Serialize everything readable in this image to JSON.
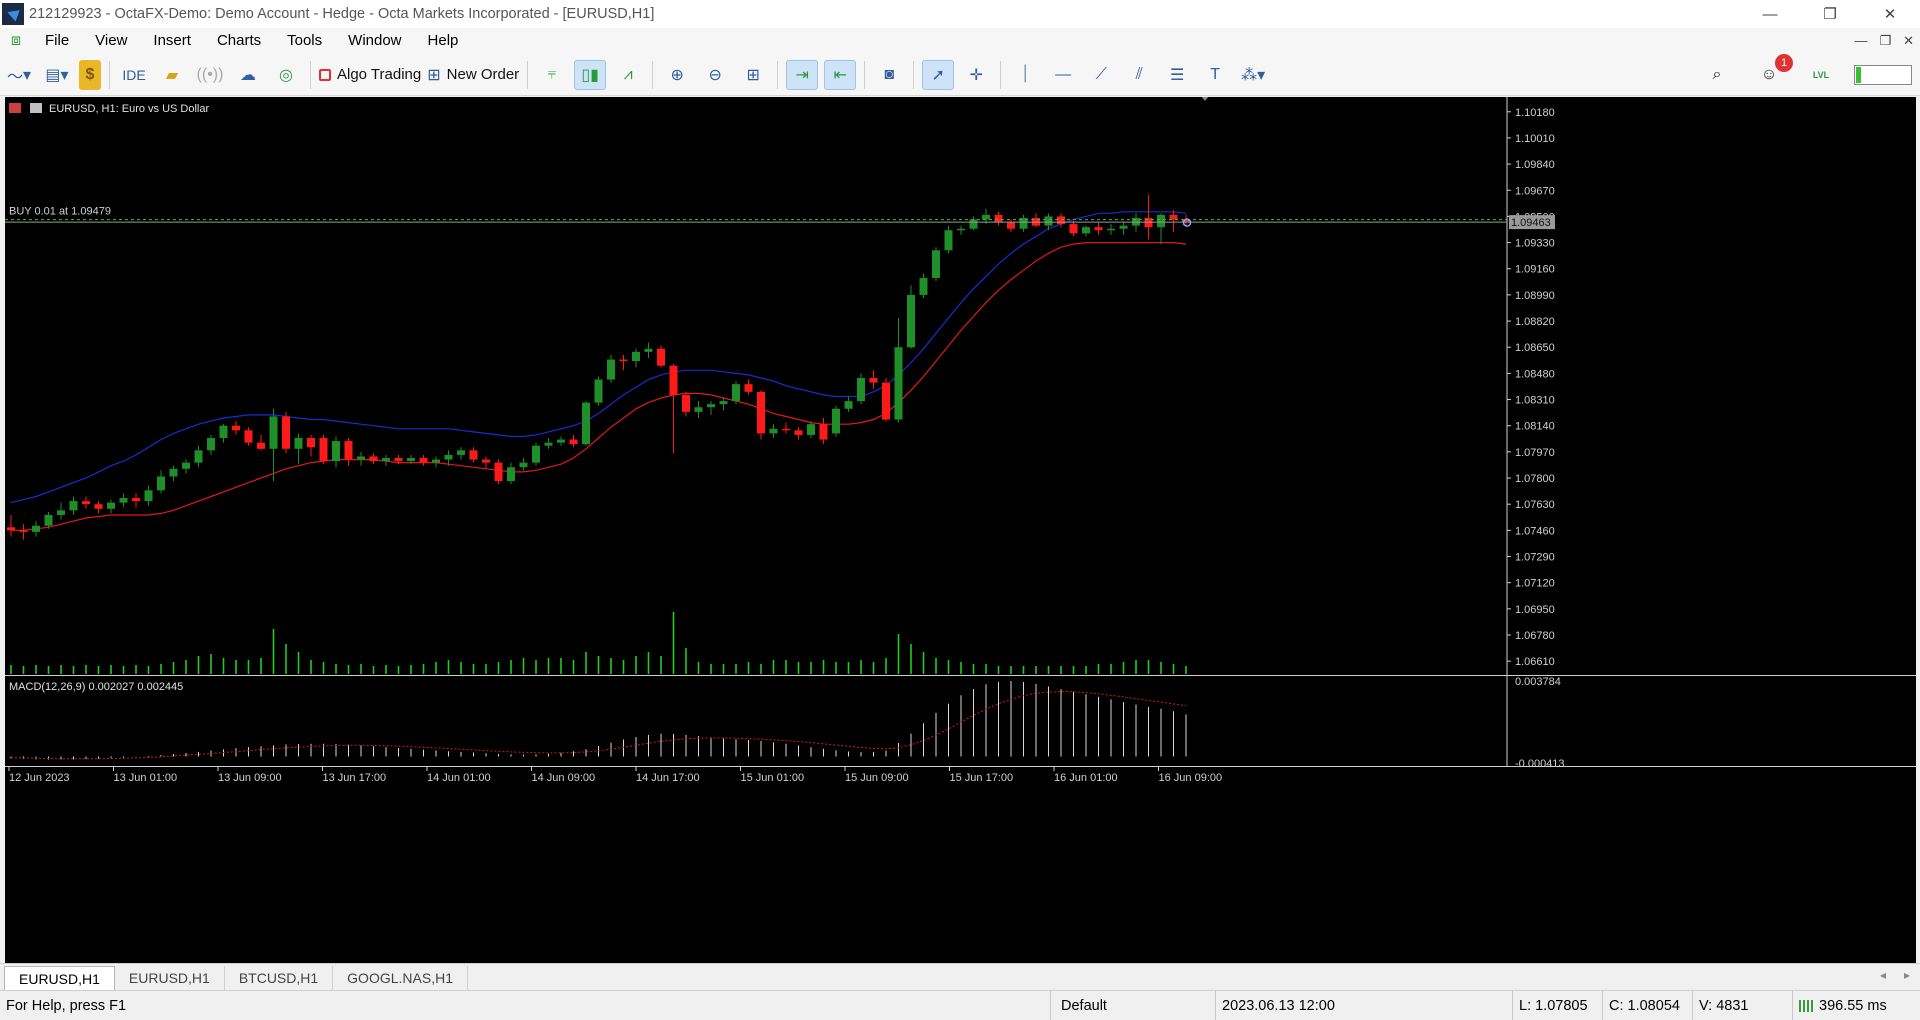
{
  "window": {
    "title": "212129923 - OctaFX-Demo: Demo Account - Hedge - Octa Markets Incorporated - [EURUSD,H1]",
    "controls": [
      "—",
      "❐",
      "✕"
    ]
  },
  "menu": {
    "items": [
      "File",
      "View",
      "Insert",
      "Charts",
      "Tools",
      "Window",
      "Help"
    ],
    "mdi_controls": [
      "—",
      "❐",
      "✕"
    ]
  },
  "toolbar": {
    "ide_label": "IDE",
    "algo_trading_label": "Algo Trading",
    "new_order_label": "New Order",
    "notification_count": "1",
    "lvl_label": "LVL",
    "signal_level": 0.1
  },
  "chart": {
    "header": "EURUSD, H1:  Euro vs US Dollar",
    "trade_line_label": "BUY 0.01 at 1.09479",
    "current_price_label": "1.09463",
    "price_axis": [
      "1.10180",
      "1.10010",
      "1.09840",
      "1.09670",
      "1.09500",
      "1.09330",
      "1.09160",
      "1.08990",
      "1.08820",
      "1.08650",
      "1.08480",
      "1.08310",
      "1.08140",
      "1.07970",
      "1.07800",
      "1.07630",
      "1.07460",
      "1.07290",
      "1.07120",
      "1.06950",
      "1.06780",
      "1.06610"
    ],
    "macd_label": "MACD(12,26,9) 0.002027 0.002445",
    "macd_axis": [
      "0.003784",
      "-0.000413"
    ],
    "time_axis": [
      "12 Jun 2023",
      "13 Jun 01:00",
      "13 Jun 09:00",
      "13 Jun 17:00",
      "14 Jun 01:00",
      "14 Jun 09:00",
      "14 Jun 17:00",
      "15 Jun 01:00",
      "15 Jun 09:00",
      "15 Jun 17:00",
      "16 Jun 01:00",
      "16 Jun 09:00"
    ],
    "colors": {
      "background": "#000000",
      "bull": "#1f8f2a",
      "bear": "#ff1a1a",
      "ma_upper": "#1c2bd4",
      "ma_lower": "#e01a1a",
      "volume": "#22cc22",
      "macd_hist": "#d8d8d8",
      "macd_signal": "#d41a1a",
      "axis_text": "#d0d0d0",
      "trade_line": "#3fbf3f"
    }
  },
  "chart_data": {
    "type": "candlestick",
    "symbol": "EURUSD",
    "timeframe": "H1",
    "ylim": [
      1.0652,
      1.1025
    ],
    "trade_price": 1.09479,
    "bid": 1.09463,
    "candles": [
      [
        1.0748,
        1.0756,
        1.0742,
        1.0746
      ],
      [
        1.0746,
        1.075,
        1.074,
        1.0745
      ],
      [
        1.0745,
        1.0752,
        1.0742,
        1.0749
      ],
      [
        1.0749,
        1.0758,
        1.0747,
        1.0756
      ],
      [
        1.0756,
        1.0764,
        1.0753,
        1.0759
      ],
      [
        1.0759,
        1.0768,
        1.0756,
        1.0765
      ],
      [
        1.0765,
        1.0768,
        1.076,
        1.0763
      ],
      [
        1.0763,
        1.0765,
        1.0757,
        1.076
      ],
      [
        1.076,
        1.0766,
        1.0757,
        1.0764
      ],
      [
        1.0764,
        1.077,
        1.0761,
        1.0767
      ],
      [
        1.0767,
        1.077,
        1.0761,
        1.0765
      ],
      [
        1.0765,
        1.0775,
        1.0762,
        1.0772
      ],
      [
        1.0772,
        1.0785,
        1.077,
        1.0781
      ],
      [
        1.0781,
        1.0788,
        1.0778,
        1.0786
      ],
      [
        1.0786,
        1.0792,
        1.0783,
        1.079
      ],
      [
        1.079,
        1.0801,
        1.0787,
        1.0798
      ],
      [
        1.0798,
        1.0808,
        1.0795,
        1.0806
      ],
      [
        1.0806,
        1.0815,
        1.0803,
        1.0814
      ],
      [
        1.0814,
        1.0817,
        1.0808,
        1.0811
      ],
      [
        1.0811,
        1.0813,
        1.0801,
        1.0803
      ],
      [
        1.0803,
        1.0808,
        1.0798,
        1.0799
      ],
      [
        1.0799,
        1.0825,
        1.0778,
        1.082
      ],
      [
        1.082,
        1.0823,
        1.0796,
        1.0799
      ],
      [
        1.0799,
        1.0809,
        1.0789,
        1.0806
      ],
      [
        1.0806,
        1.0808,
        1.0794,
        1.08
      ],
      [
        1.0806,
        1.0808,
        1.0789,
        1.0791
      ],
      [
        1.0791,
        1.0807,
        1.0787,
        1.0804
      ],
      [
        1.0804,
        1.0806,
        1.0788,
        1.0792
      ],
      [
        1.0792,
        1.0797,
        1.0788,
        1.0794
      ],
      [
        1.0794,
        1.0796,
        1.0789,
        1.0791
      ],
      [
        1.0791,
        1.0795,
        1.0788,
        1.0793
      ],
      [
        1.0793,
        1.0795,
        1.0789,
        1.0791
      ],
      [
        1.0791,
        1.0795,
        1.0789,
        1.0793
      ],
      [
        1.0793,
        1.0795,
        1.0788,
        1.079
      ],
      [
        1.079,
        1.0794,
        1.0787,
        1.0792
      ],
      [
        1.0792,
        1.0798,
        1.0788,
        1.0795
      ],
      [
        1.0795,
        1.08,
        1.0792,
        1.0798
      ],
      [
        1.0798,
        1.08,
        1.079,
        1.0792
      ],
      [
        1.0792,
        1.0794,
        1.0786,
        1.079
      ],
      [
        1.079,
        1.0792,
        1.0776,
        1.0778
      ],
      [
        1.0778,
        1.079,
        1.0776,
        1.0787
      ],
      [
        1.0787,
        1.0793,
        1.0785,
        1.079
      ],
      [
        1.079,
        1.0803,
        1.0788,
        1.0801
      ],
      [
        1.0801,
        1.0806,
        1.0799,
        1.0803
      ],
      [
        1.0803,
        1.0807,
        1.0801,
        1.0805
      ],
      [
        1.0805,
        1.0808,
        1.08,
        1.0802
      ],
      [
        1.0802,
        1.083,
        1.0801,
        1.0829
      ],
      [
        1.0829,
        1.0846,
        1.0827,
        1.0844
      ],
      [
        1.0844,
        1.086,
        1.0842,
        1.0857
      ],
      [
        1.0857,
        1.086,
        1.085,
        1.0856
      ],
      [
        1.0856,
        1.0864,
        1.0852,
        1.0862
      ],
      [
        1.0862,
        1.0868,
        1.0858,
        1.0864
      ],
      [
        1.0864,
        1.0866,
        1.0852,
        1.0853
      ],
      [
        1.0853,
        1.0854,
        1.0796,
        1.0834
      ],
      [
        1.0834,
        1.0836,
        1.082,
        1.0823
      ],
      [
        1.0823,
        1.083,
        1.0819,
        1.0826
      ],
      [
        1.0826,
        1.083,
        1.0821,
        1.0828
      ],
      [
        1.0828,
        1.0832,
        1.0824,
        1.083
      ],
      [
        1.083,
        1.0843,
        1.0828,
        1.0841
      ],
      [
        1.0841,
        1.0844,
        1.0834,
        1.0836
      ],
      [
        1.0836,
        1.0837,
        1.0805,
        1.0809
      ],
      [
        1.0809,
        1.0815,
        1.0806,
        1.0812
      ],
      [
        1.0812,
        1.0816,
        1.0809,
        1.0811
      ],
      [
        1.0811,
        1.0813,
        1.0805,
        1.0808
      ],
      [
        1.0808,
        1.0817,
        1.0806,
        1.0815
      ],
      [
        1.0815,
        1.0819,
        1.0802,
        1.0805
      ],
      [
        1.0809,
        1.0827,
        1.0807,
        1.0825
      ],
      [
        1.0825,
        1.0833,
        1.0823,
        1.083
      ],
      [
        1.083,
        1.0848,
        1.0828,
        1.0845
      ],
      [
        1.0845,
        1.085,
        1.0838,
        1.0842
      ],
      [
        1.0842,
        1.0845,
        1.0817,
        1.0818
      ],
      [
        1.0818,
        1.0884,
        1.0816,
        1.0865
      ],
      [
        1.0865,
        1.0905,
        1.0864,
        1.0899
      ],
      [
        1.0899,
        1.0913,
        1.0897,
        1.091
      ],
      [
        1.091,
        1.093,
        1.0908,
        1.0928
      ],
      [
        1.0928,
        1.0944,
        1.0926,
        1.0941
      ],
      [
        1.0941,
        1.0944,
        1.0938,
        1.0942
      ],
      [
        1.0942,
        1.095,
        1.0941,
        1.0948
      ],
      [
        1.0948,
        1.0955,
        1.0945,
        1.0951
      ],
      [
        1.0951,
        1.0953,
        1.0944,
        1.0946
      ],
      [
        1.0946,
        1.0948,
        1.094,
        1.0942
      ],
      [
        1.0942,
        1.0951,
        1.094,
        1.0949
      ],
      [
        1.0949,
        1.0952,
        1.0943,
        1.0944
      ],
      [
        1.0944,
        1.0952,
        1.0941,
        1.095
      ],
      [
        1.095,
        1.0952,
        1.0943,
        1.0945
      ],
      [
        1.0945,
        1.0947,
        1.0937,
        1.0939
      ],
      [
        1.0939,
        1.0944,
        1.0937,
        1.0943
      ],
      [
        1.0943,
        1.0946,
        1.0938,
        1.0941
      ],
      [
        1.0941,
        1.0945,
        1.0938,
        1.0942
      ],
      [
        1.0942,
        1.0946,
        1.0938,
        1.0944
      ],
      [
        1.0944,
        1.0952,
        1.094,
        1.0949
      ],
      [
        1.0949,
        1.0964,
        1.0935,
        1.0943
      ],
      [
        1.0943,
        1.0952,
        1.0932,
        1.0951
      ],
      [
        1.0951,
        1.0954,
        1.094,
        1.0948
      ],
      [
        1.0948,
        1.0951,
        1.0944,
        1.09463
      ]
    ],
    "ma_upper": [
      1.0764,
      1.0766,
      1.0768,
      1.0771,
      1.0774,
      1.0777,
      1.078,
      1.0784,
      1.0788,
      1.0791,
      1.0795,
      1.08,
      1.0805,
      1.0809,
      1.0812,
      1.0815,
      1.0817,
      1.0819,
      1.082,
      1.0821,
      1.0821,
      1.0821,
      1.082,
      1.0819,
      1.0818,
      1.0818,
      1.0817,
      1.0816,
      1.0815,
      1.0814,
      1.0813,
      1.0812,
      1.0812,
      1.0812,
      1.0812,
      1.0812,
      1.0811,
      1.081,
      1.0809,
      1.0808,
      1.0807,
      1.0807,
      1.0808,
      1.081,
      1.0812,
      1.0814,
      1.0817,
      1.0822,
      1.0828,
      1.0834,
      1.0839,
      1.0844,
      1.0847,
      1.0849,
      1.085,
      1.085,
      1.085,
      1.0849,
      1.0848,
      1.0847,
      1.0845,
      1.0843,
      1.084,
      1.0838,
      1.0836,
      1.0834,
      1.0833,
      1.0833,
      1.0833,
      1.0836,
      1.084,
      1.0847,
      1.0855,
      1.0864,
      1.0874,
      1.0884,
      1.0894,
      1.0903,
      1.0911,
      1.0919,
      1.0926,
      1.0932,
      1.0937,
      1.0942,
      1.0945,
      1.0948,
      1.095,
      1.0952,
      1.0952,
      1.0953,
      1.0953,
      1.0953,
      1.0953,
      1.0953,
      1.0952
    ],
    "ma_lower": [
      1.0746,
      1.0746,
      1.0747,
      1.0748,
      1.075,
      1.0752,
      1.0754,
      1.0755,
      1.0756,
      1.0756,
      1.0756,
      1.0756,
      1.0757,
      1.0759,
      1.0762,
      1.0765,
      1.0768,
      1.0771,
      1.0774,
      1.0777,
      1.078,
      1.0783,
      1.0786,
      1.0788,
      1.079,
      1.0791,
      1.0792,
      1.0792,
      1.0792,
      1.0792,
      1.0791,
      1.079,
      1.079,
      1.079,
      1.079,
      1.0789,
      1.0788,
      1.0787,
      1.0786,
      1.0785,
      1.0784,
      1.0784,
      1.0785,
      1.0787,
      1.0789,
      1.0793,
      1.0799,
      1.0806,
      1.0813,
      1.0819,
      1.0825,
      1.0829,
      1.0832,
      1.0834,
      1.0835,
      1.0835,
      1.0834,
      1.0832,
      1.083,
      1.0828,
      1.0825,
      1.0822,
      1.082,
      1.0818,
      1.0816,
      1.0815,
      1.0815,
      1.0815,
      1.0816,
      1.0818,
      1.0822,
      1.0829,
      1.0837,
      1.0846,
      1.0856,
      1.0866,
      1.0876,
      1.0885,
      1.0894,
      1.0902,
      1.0909,
      1.0915,
      1.0921,
      1.0926,
      1.093,
      1.0932,
      1.0933,
      1.0933,
      1.0933,
      1.0933,
      1.0933,
      1.0933,
      1.0933,
      1.0933,
      1.0932
    ],
    "volume": [
      9,
      8,
      9,
      8,
      9,
      8,
      9,
      8,
      9,
      8,
      9,
      8,
      10,
      12,
      14,
      18,
      20,
      16,
      14,
      14,
      16,
      45,
      30,
      22,
      14,
      12,
      10,
      9,
      10,
      8,
      9,
      8,
      9,
      10,
      12,
      14,
      12,
      10,
      10,
      12,
      14,
      16,
      14,
      16,
      16,
      14,
      22,
      18,
      16,
      14,
      18,
      22,
      18,
      62,
      26,
      12,
      10,
      10,
      10,
      12,
      10,
      14,
      14,
      12,
      12,
      14,
      12,
      12,
      14,
      12,
      16,
      40,
      30,
      22,
      16,
      14,
      12,
      10,
      10,
      8,
      8,
      8,
      8,
      8,
      8,
      8,
      8,
      10,
      10,
      12,
      14,
      14,
      12,
      10,
      8
    ],
    "macd_ylim": [
      -0.000413,
      0.003784
    ],
    "macd": [
      -0.0001,
      -0.00012,
      -0.00014,
      -0.00015,
      -0.00015,
      -0.00014,
      -0.00013,
      -0.00011,
      -8e-05,
      -5e-05,
      -2e-05,
      2e-05,
      7e-05,
      0.00012,
      0.00017,
      0.00022,
      0.00028,
      0.00034,
      0.0004,
      0.00045,
      0.00049,
      0.00054,
      0.00058,
      0.0006,
      0.00061,
      0.00061,
      0.0006,
      0.00057,
      0.00053,
      0.00049,
      0.00045,
      0.00041,
      0.00037,
      0.00033,
      0.00029,
      0.00025,
      0.00022,
      0.00019,
      0.00016,
      0.00012,
      0.0001,
      9e-05,
      0.0001,
      0.00013,
      0.00018,
      0.00025,
      0.00035,
      0.0005,
      0.00066,
      0.00082,
      0.00094,
      0.00104,
      0.0011,
      0.00109,
      0.00104,
      0.00098,
      0.00092,
      0.00087,
      0.00083,
      0.0008,
      0.00075,
      0.00068,
      0.00061,
      0.00053,
      0.00045,
      0.00037,
      0.0003,
      0.00024,
      0.00021,
      0.00022,
      0.00028,
      0.00065,
      0.0011,
      0.0016,
      0.0021,
      0.00255,
      0.00295,
      0.00325,
      0.00348,
      0.0036,
      0.00364,
      0.0036,
      0.0035,
      0.00338,
      0.00325,
      0.00312,
      0.003,
      0.00288,
      0.00275,
      0.00262,
      0.0025,
      0.0024,
      0.0023,
      0.00218,
      0.00203
    ],
    "macd_signal": [
      -5e-05,
      -7e-05,
      -9e-05,
      -0.0001,
      -0.00011,
      -0.00011,
      -0.00011,
      -0.00011,
      -0.0001,
      -9e-05,
      -7e-05,
      -5e-05,
      -2e-05,
      2e-05,
      6e-05,
      0.0001,
      0.00014,
      0.00019,
      0.00023,
      0.00028,
      0.00033,
      0.00037,
      0.00041,
      0.00045,
      0.00048,
      0.00051,
      0.00053,
      0.00054,
      0.00054,
      0.00053,
      0.00052,
      0.0005,
      0.00047,
      0.00044,
      0.00041,
      0.00038,
      0.00035,
      0.00031,
      0.00028,
      0.00025,
      0.00022,
      0.0002,
      0.00018,
      0.00017,
      0.00017,
      0.00019,
      0.00022,
      0.00027,
      0.00035,
      0.00044,
      0.00054,
      0.00064,
      0.00073,
      0.0008,
      0.00085,
      0.00088,
      0.00089,
      0.00089,
      0.00088,
      0.00086,
      0.00084,
      0.0008,
      0.00076,
      0.00072,
      0.00067,
      0.00061,
      0.00055,
      0.00049,
      0.00043,
      0.00039,
      0.00037,
      0.00042,
      0.00056,
      0.00077,
      0.00103,
      0.00133,
      0.00166,
      0.00198,
      0.00228,
      0.00254,
      0.00276,
      0.00293,
      0.00305,
      0.00311,
      0.00313,
      0.00312,
      0.00308,
      0.00302,
      0.00295,
      0.00287,
      0.00279,
      0.0027,
      0.00262,
      0.00253,
      0.00245
    ]
  },
  "tabs": [
    "EURUSD,H1",
    "EURUSD,H1",
    "BTCUSD,H1",
    "GOOGL.NAS,H1"
  ],
  "tab_nav": [
    "◂",
    "▸"
  ],
  "status": {
    "help": "For Help, press F1",
    "profile": "Default",
    "datetime": "2023.06.13 12:00",
    "low": "L: 1.07805",
    "close": "C: 1.08054",
    "volume": "V: 4831",
    "ping": "396.55 ms"
  }
}
